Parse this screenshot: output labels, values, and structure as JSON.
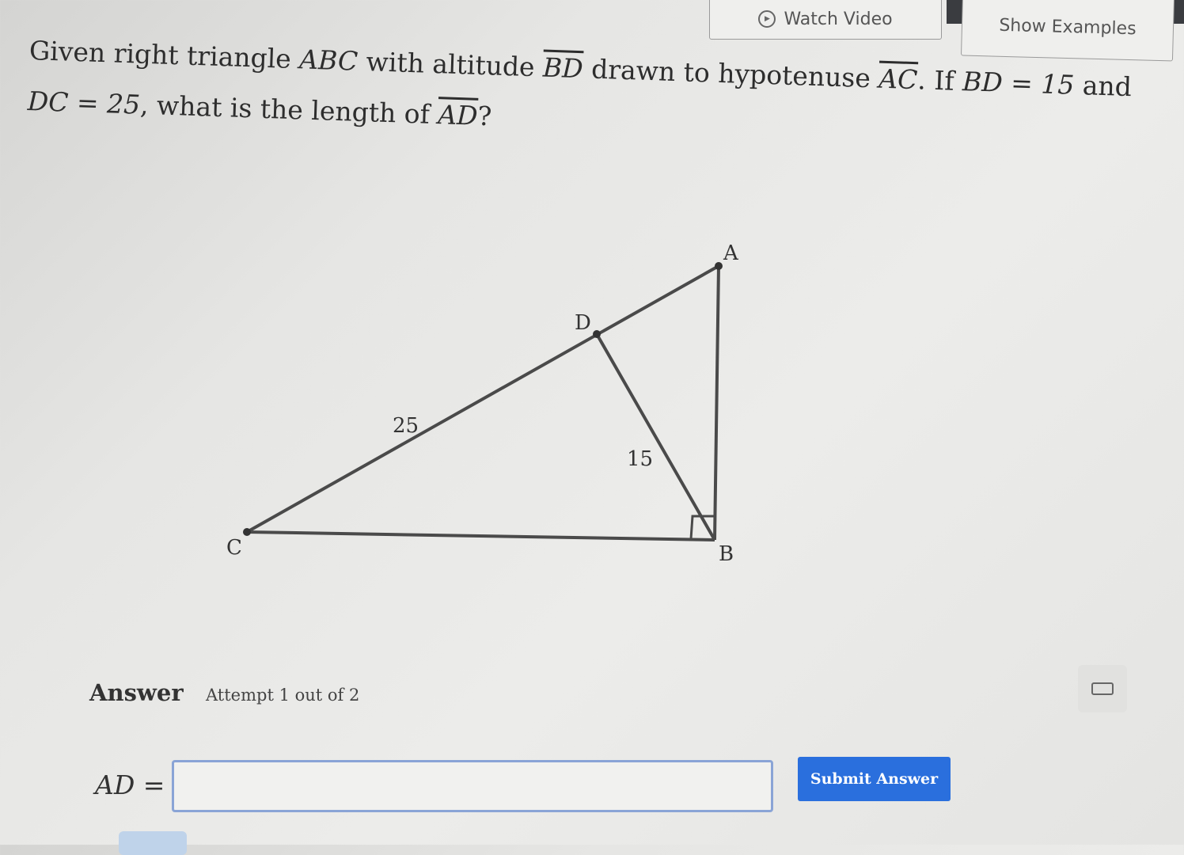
{
  "header": {
    "watch_video_label": "Watch Video",
    "show_examples_label": "Show Examples"
  },
  "question": {
    "part1": "Given right triangle ",
    "triangle": "ABC",
    "part2": " with altitude ",
    "altitude": "BD",
    "part3": " drawn to hypotenuse ",
    "hypotenuse": "AC",
    "part4": ". If ",
    "bd_eq": "BD = 15",
    "part5": " and ",
    "dc_eq": "DC = 25",
    "part6": ", what is the length of ",
    "target": "AD",
    "part7": "?"
  },
  "diagram": {
    "labels": {
      "A": "A",
      "B": "B",
      "C": "C",
      "D": "D"
    },
    "length_dc": "25",
    "length_bd": "15"
  },
  "answer": {
    "heading": "Answer",
    "attempt_text": "Attempt 1 out of 2",
    "input_label": "AD =",
    "input_value": "",
    "submit_label": "Submit Answer"
  }
}
